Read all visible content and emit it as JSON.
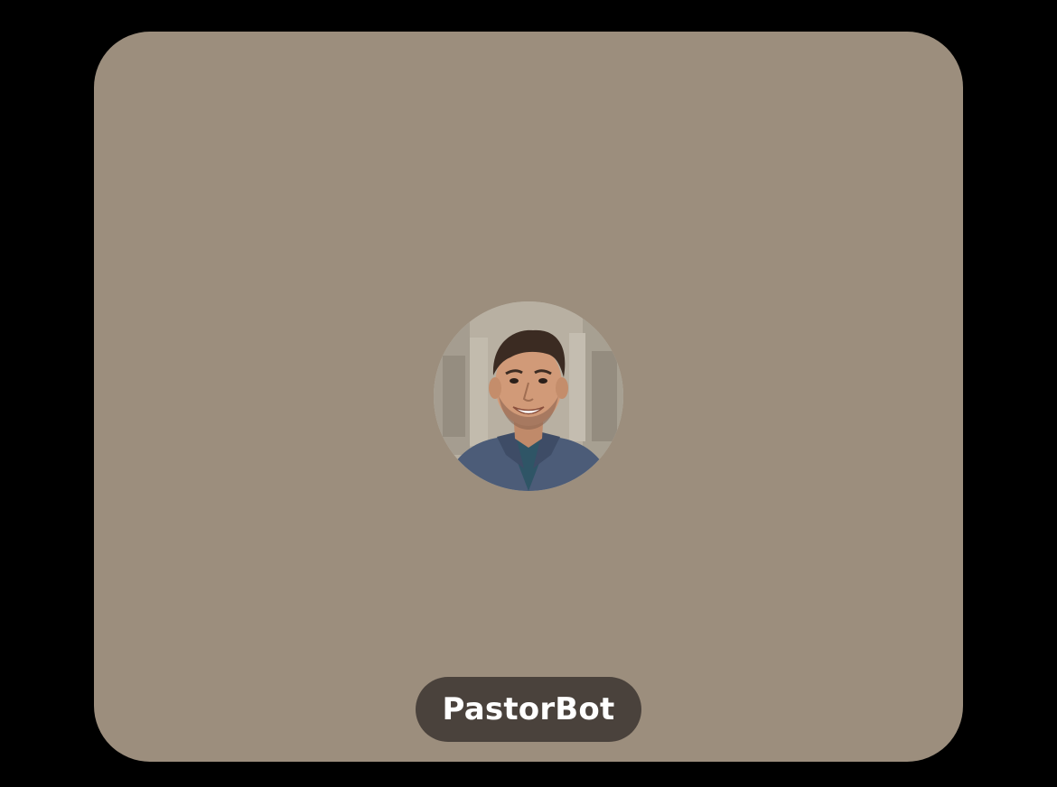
{
  "participant": {
    "name": "PastorBot",
    "avatar_icon": "participant-avatar"
  },
  "colors": {
    "page_background": "#000000",
    "tile_background": "#9c8e7d",
    "name_pill_background": "#4a423c",
    "name_text": "#ffffff"
  }
}
